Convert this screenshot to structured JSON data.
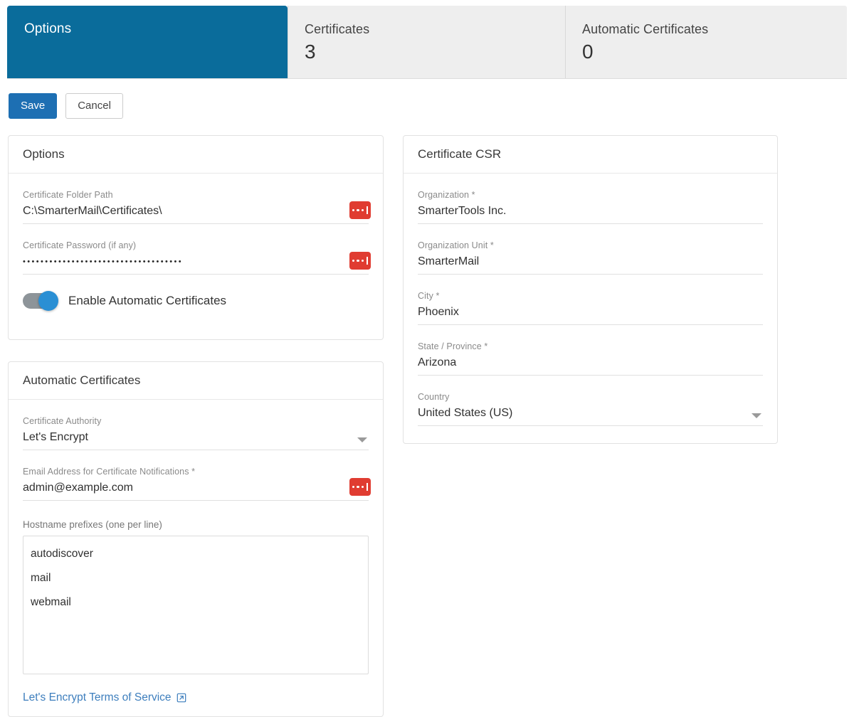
{
  "tabs": [
    {
      "label": "Options",
      "count": "",
      "active": true
    },
    {
      "label": "Certificates",
      "count": "3",
      "active": false
    },
    {
      "label": "Automatic Certificates",
      "count": "0",
      "active": false
    }
  ],
  "toolbar": {
    "save_label": "Save",
    "cancel_label": "Cancel"
  },
  "options_card": {
    "title": "Options",
    "folder_path": {
      "label": "Certificate Folder Path",
      "value": "C:\\SmarterMail\\Certificates\\",
      "icon": "variable-picker-icon"
    },
    "password": {
      "label": "Certificate Password (if any)",
      "value": "••••••••••••••••••••••••••••••••••••",
      "icon": "variable-picker-icon"
    },
    "enable_auto": {
      "label": "Enable Automatic Certificates",
      "state": "on"
    }
  },
  "auto_card": {
    "title": "Automatic Certificates",
    "authority": {
      "label": "Certificate Authority",
      "value": "Let's Encrypt",
      "icon": "chevron-down-icon"
    },
    "email": {
      "label": "Email Address for Certificate Notifications *",
      "value": "admin@example.com",
      "icon": "variable-picker-icon"
    },
    "hostnames": {
      "label": "Hostname prefixes (one per line)",
      "value": "autodiscover\nmail\nwebmail"
    },
    "tos": {
      "label": "Let's Encrypt Terms of Service",
      "icon": "external-link-icon"
    }
  },
  "csr_card": {
    "title": "Certificate CSR",
    "fields": [
      {
        "label": "Organization *",
        "value": "SmarterTools Inc.",
        "type": "text"
      },
      {
        "label": "Organization Unit *",
        "value": "SmarterMail",
        "type": "text"
      },
      {
        "label": "City *",
        "value": "Phoenix",
        "type": "text"
      },
      {
        "label": "State / Province *",
        "value": "Arizona",
        "type": "text"
      },
      {
        "label": "Country",
        "value": "United States (US)",
        "type": "select"
      }
    ]
  },
  "colors": {
    "active_tab": "#0a6c9b",
    "primary_button": "#1d6fb3",
    "accent_red": "#e03c31",
    "toggle_on": "#2a8fd4",
    "link": "#3d7ebd"
  }
}
